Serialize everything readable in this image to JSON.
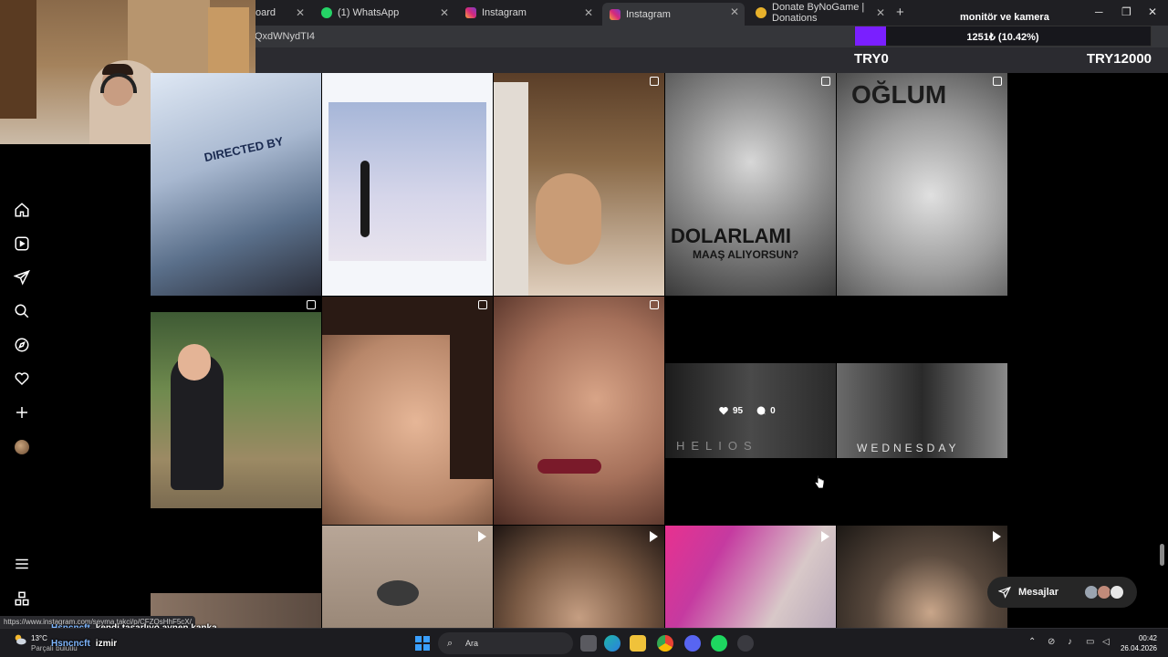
{
  "browser": {
    "tabs": [
      {
        "title": "oard",
        "favicon": "dashboard-icon",
        "active": false
      },
      {
        "title": "(1) WhatsApp",
        "favicon": "whatsapp-icon",
        "active": false
      },
      {
        "title": "Instagram",
        "favicon": "instagram-icon",
        "active": false
      },
      {
        "title": "Instagram",
        "favicon": "instagram-icon",
        "active": true
      },
      {
        "title": "Donate ByNoGame | Donations",
        "favicon": "bynogame-icon",
        "active": false
      }
    ],
    "new_tab_label": "+",
    "url_fragment": "QxdWNydTI4",
    "window_controls": {
      "minimize": "─",
      "restore": "❐",
      "close": "✕"
    }
  },
  "donation_overlay": {
    "title": "monitör ve kamera",
    "progress_text": "1251₺ (10.42%)",
    "progress_fraction": 0.1042,
    "min_label": "TRY0",
    "max_label": "TRY12000",
    "fill_color": "#7a1fff"
  },
  "sidebar": {
    "items": [
      {
        "name": "home",
        "icon": "home-icon"
      },
      {
        "name": "reels",
        "icon": "reels-icon"
      },
      {
        "name": "messages",
        "icon": "paper-plane-icon"
      },
      {
        "name": "search",
        "icon": "search-icon"
      },
      {
        "name": "explore",
        "icon": "compass-icon"
      },
      {
        "name": "notifications",
        "icon": "heart-icon"
      },
      {
        "name": "create",
        "icon": "plus-icon"
      },
      {
        "name": "profile",
        "icon": "avatar"
      }
    ],
    "bottom": [
      {
        "name": "more",
        "icon": "menu-icon"
      },
      {
        "name": "also-from-meta",
        "icon": "apps-icon"
      }
    ]
  },
  "grid": {
    "tile_texts": {
      "dolarla": "DOLARLAMI",
      "maas": "MAAŞ ALIYORSUN?",
      "oglum": "OĞLUM",
      "helios": "HELIOS",
      "wednesday": "WEDNESDAY",
      "director": "DIRECTED BY"
    },
    "hover": {
      "likes": "95",
      "comments": "0"
    }
  },
  "messages_pill": {
    "label": "Mesajlar"
  },
  "status_url": "https://www.instagram.com/seyma.takci/p/CFZQsHhF5cX/",
  "chat": [
    {
      "user": "Hsncncft",
      "message": "kendi tasarlıyo aynen kanka"
    },
    {
      "user": "Hsncncft",
      "message": "izmir"
    }
  ],
  "taskbar": {
    "weather_temp": "13°C",
    "weather_desc": "Parçalı bulutlu",
    "search_label": "Ara",
    "time": "00:42",
    "date": "26.04.2026"
  }
}
